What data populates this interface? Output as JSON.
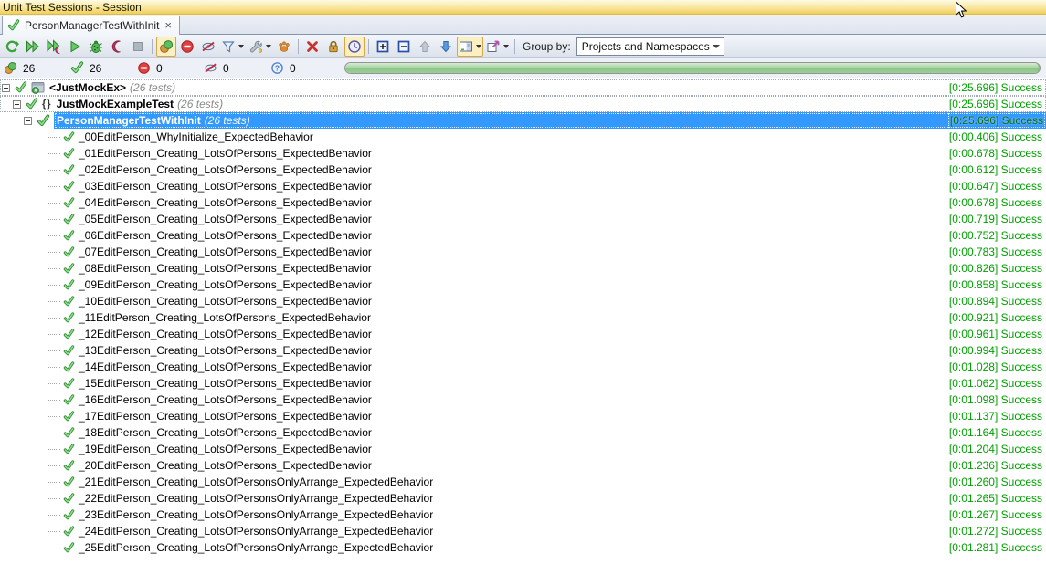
{
  "window": {
    "title": "Unit Test Sessions - Session"
  },
  "tab": {
    "label": "PersonManagerTestWithInit",
    "close_glyph": "×",
    "status_icon": "success-check-icon"
  },
  "toolbar": {
    "buttons": [
      "repeat-previous-run",
      "run-all-tests",
      "run-all-tests-profiled",
      "run-selected-tests",
      "debug-selected-tests",
      "profile-selected-tests",
      "stop-execution",
      "unit-tests-indicator",
      "show-failed-tests-only",
      "show-ignored-tests",
      "filter-tests",
      "test-settings",
      "track-running-test",
      "remove-session",
      "lock-session",
      "show-test-time",
      "expand-all",
      "collapse-all",
      "previous-test",
      "next-test",
      "toggle-preview-pane",
      "export-results"
    ],
    "highlighted_buttons": [
      "unit-tests-indicator",
      "show-test-time",
      "toggle-preview-pane"
    ],
    "disabled_buttons": [
      "stop-execution",
      "previous-test"
    ],
    "group_by_label": "Group by:",
    "group_by_value": "Projects and Namespaces"
  },
  "summary": {
    "total": "26",
    "passed": "26",
    "failed": "0",
    "ignored": "0",
    "inconclusive": "0",
    "progress_percent": 100
  },
  "icons": {
    "namespace_glyph": "{}"
  },
  "colors": {
    "selection": "#3399FF",
    "success_text": "#00A000",
    "progress_fill": "#9CCF97",
    "titlebar_gold": "#F2CE57",
    "toolbar_highlight": "#FCEFC0"
  },
  "tree": {
    "groups": [
      {
        "label": "<JustMockEx>",
        "count": "(26 tests)",
        "time": "[0:25.696]",
        "status": "Success",
        "icon": "csharp-project",
        "selected": false
      },
      {
        "label": "JustMockExampleTest",
        "count": "(26 tests)",
        "time": "[0:25.696]",
        "status": "Success",
        "icon": "namespace",
        "selected": false
      },
      {
        "label": "PersonManagerTestWithInit",
        "count": "(26 tests)",
        "time": "[0:25.696]",
        "status": "Success",
        "icon": "none",
        "selected": true
      }
    ],
    "tests": [
      {
        "name": "_00EditPerson_WhyInitialize_ExpectedBehavior",
        "time": "[0:00.406]",
        "status": "Success"
      },
      {
        "name": "_01EditPerson_Creating_LotsOfPersons_ExpectedBehavior",
        "time": "[0:00.678]",
        "status": "Success"
      },
      {
        "name": "_02EditPerson_Creating_LotsOfPersons_ExpectedBehavior",
        "time": "[0:00.612]",
        "status": "Success"
      },
      {
        "name": "_03EditPerson_Creating_LotsOfPersons_ExpectedBehavior",
        "time": "[0:00.647]",
        "status": "Success"
      },
      {
        "name": "_04EditPerson_Creating_LotsOfPersons_ExpectedBehavior",
        "time": "[0:00.678]",
        "status": "Success"
      },
      {
        "name": "_05EditPerson_Creating_LotsOfPersons_ExpectedBehavior",
        "time": "[0:00.719]",
        "status": "Success"
      },
      {
        "name": "_06EditPerson_Creating_LotsOfPersons_ExpectedBehavior",
        "time": "[0:00.752]",
        "status": "Success"
      },
      {
        "name": "_07EditPerson_Creating_LotsOfPersons_ExpectedBehavior",
        "time": "[0:00.783]",
        "status": "Success"
      },
      {
        "name": "_08EditPerson_Creating_LotsOfPersons_ExpectedBehavior",
        "time": "[0:00.826]",
        "status": "Success"
      },
      {
        "name": "_09EditPerson_Creating_LotsOfPersons_ExpectedBehavior",
        "time": "[0:00.858]",
        "status": "Success"
      },
      {
        "name": "_10EditPerson_Creating_LotsOfPersons_ExpectedBehavior",
        "time": "[0:00.894]",
        "status": "Success"
      },
      {
        "name": "_11EditPerson_Creating_LotsOfPersons_ExpectedBehavior",
        "time": "[0:00.921]",
        "status": "Success"
      },
      {
        "name": "_12EditPerson_Creating_LotsOfPersons_ExpectedBehavior",
        "time": "[0:00.961]",
        "status": "Success"
      },
      {
        "name": "_13EditPerson_Creating_LotsOfPersons_ExpectedBehavior",
        "time": "[0:00.994]",
        "status": "Success"
      },
      {
        "name": "_14EditPerson_Creating_LotsOfPersons_ExpectedBehavior",
        "time": "[0:01.028]",
        "status": "Success"
      },
      {
        "name": "_15EditPerson_Creating_LotsOfPersons_ExpectedBehavior",
        "time": "[0:01.062]",
        "status": "Success"
      },
      {
        "name": "_16EditPerson_Creating_LotsOfPersons_ExpectedBehavior",
        "time": "[0:01.098]",
        "status": "Success"
      },
      {
        "name": "_17EditPerson_Creating_LotsOfPersons_ExpectedBehavior",
        "time": "[0:01.137]",
        "status": "Success"
      },
      {
        "name": "_18EditPerson_Creating_LotsOfPersons_ExpectedBehavior",
        "time": "[0:01.164]",
        "status": "Success"
      },
      {
        "name": "_19EditPerson_Creating_LotsOfPersons_ExpectedBehavior",
        "time": "[0:01.204]",
        "status": "Success"
      },
      {
        "name": "_20EditPerson_Creating_LotsOfPersons_ExpectedBehavior",
        "time": "[0:01.236]",
        "status": "Success"
      },
      {
        "name": "_21EditPerson_Creating_LotsOfPersonsOnlyArrange_ExpectedBehavior",
        "time": "[0:01.260]",
        "status": "Success"
      },
      {
        "name": "_22EditPerson_Creating_LotsOfPersonsOnlyArrange_ExpectedBehavior",
        "time": "[0:01.265]",
        "status": "Success"
      },
      {
        "name": "_23EditPerson_Creating_LotsOfPersonsOnlyArrange_ExpectedBehavior",
        "time": "[0:01.267]",
        "status": "Success"
      },
      {
        "name": "_24EditPerson_Creating_LotsOfPersonsOnlyArrange_ExpectedBehavior",
        "time": "[0:01.272]",
        "status": "Success"
      },
      {
        "name": "_25EditPerson_Creating_LotsOfPersonsOnlyArrange_ExpectedBehavior",
        "time": "[0:01.281]",
        "status": "Success"
      }
    ]
  }
}
